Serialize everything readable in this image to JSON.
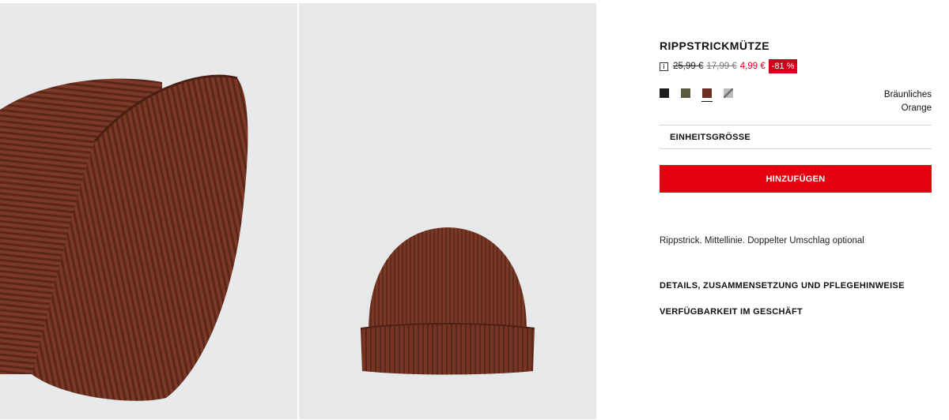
{
  "product": {
    "title": "RIPPSTRICKMÜTZE",
    "price_original": "25,99 €",
    "price_previous": "17,99 €",
    "price_current": "4,99 €",
    "discount_badge": "-81 %",
    "info_icon": "info-icon",
    "info_icon_glyph": "i"
  },
  "colors": {
    "swatches": [
      {
        "name": "black-swatch",
        "hex": "#1c1c1c"
      },
      {
        "name": "olive-swatch",
        "hex": "#5c5a3e"
      },
      {
        "name": "brown-swatch",
        "hex": "#6a2e22",
        "selected": true
      },
      {
        "name": "grey-pattern-swatch",
        "hex": "#9a9a9a"
      }
    ],
    "selected_name_line1": "Bräunliches",
    "selected_name_line2": "Orange"
  },
  "size": {
    "label": "EINHEITSGRÖSSE"
  },
  "actions": {
    "add_label": "HINZUFÜGEN",
    "accent": "#e3000f"
  },
  "details": {
    "description": "Rippstrick. Mittellinie. Doppelter Umschlag optional",
    "details_link": "DETAILS, ZUSAMMENSETZUNG UND PFLEGEHINWEISE",
    "store_link": "VERFÜGBARKEIT IM GESCHÄFT"
  },
  "gallery": {
    "images": [
      "beanie-closeup-photo",
      "beanie-full-photo"
    ]
  }
}
